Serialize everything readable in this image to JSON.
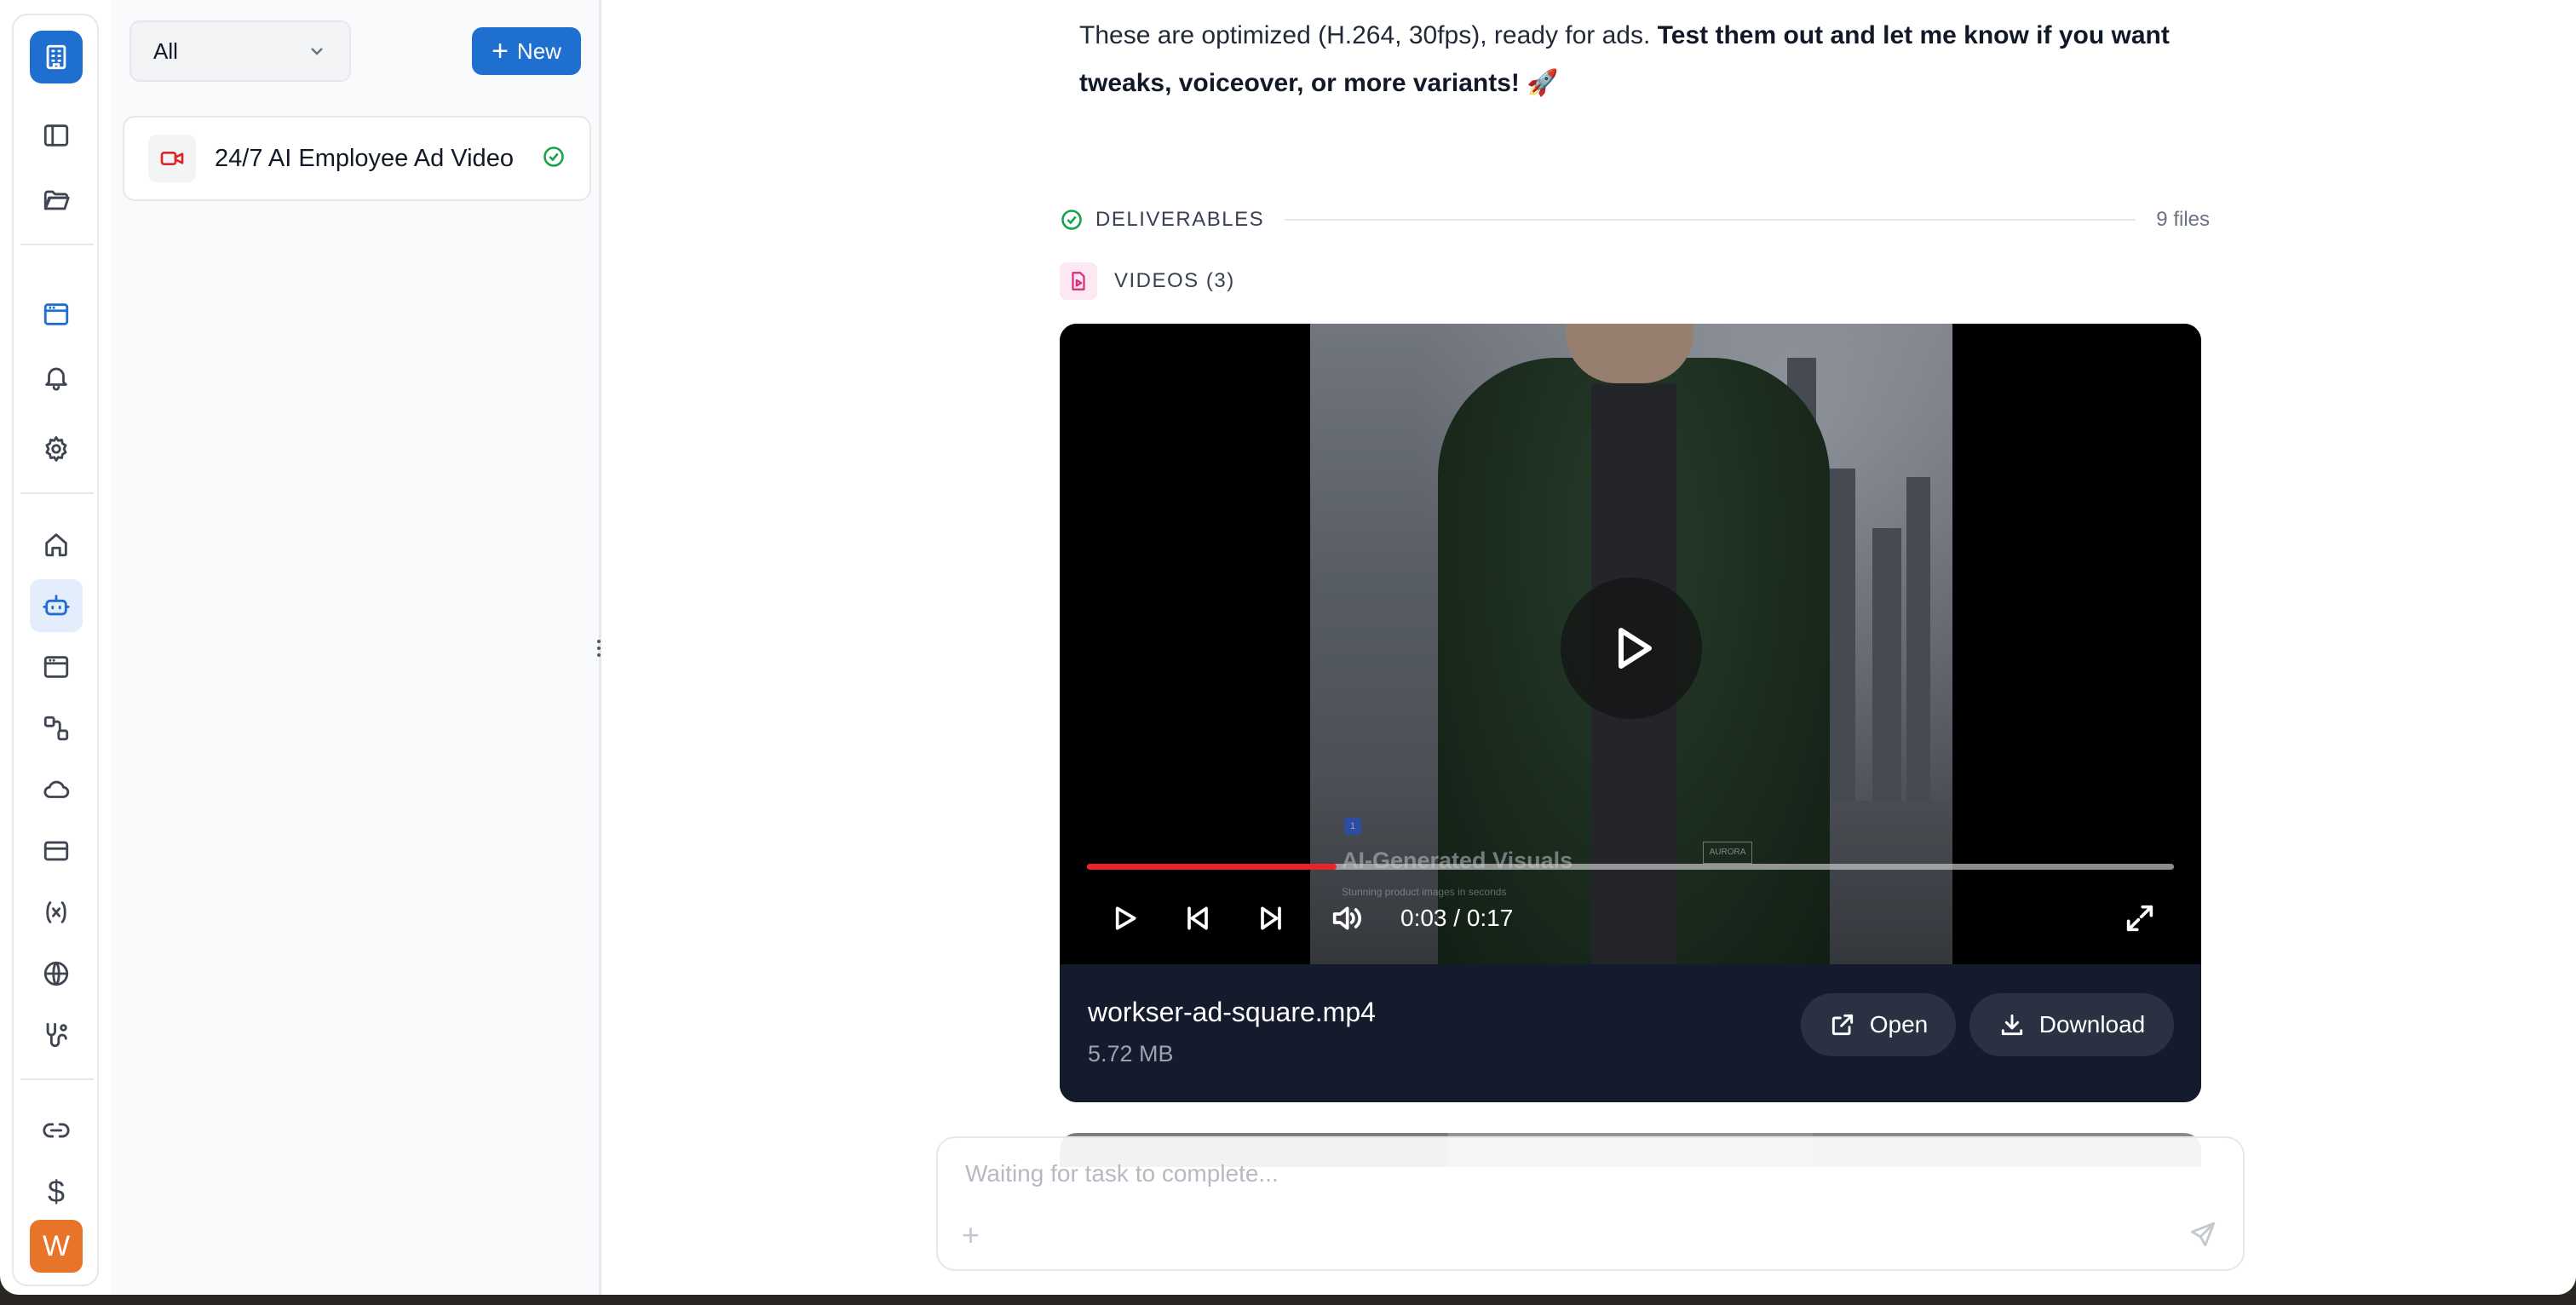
{
  "sidebar": {
    "filter_value": "All",
    "new_label": "New",
    "user_initial": "W",
    "dollar_symbol": "$"
  },
  "tasks": [
    {
      "title": "24/7 AI Employee Ad Video",
      "status": "completed"
    }
  ],
  "message": {
    "plain": "These are optimized (H.264, 30fps), ready for ads. ",
    "bold": "Test them out and let me know if you want tweaks, voiceover, or more variants! 🚀"
  },
  "deliverables": {
    "label": "DELIVERABLES",
    "count": "9 files",
    "videos_label": "VIDEOS (3)"
  },
  "video": {
    "time": "0:03 / 0:17",
    "progress": 0.23,
    "watermark_title": "AI-Generated Visuals",
    "watermark_sub": "Stunning product images in seconds",
    "watermark_brand": "AURORA",
    "file_name": "workser-ad-square.mp4",
    "file_size": "5.72 MB",
    "open_label": "Open",
    "download_label": "Download"
  },
  "composer": {
    "placeholder": "Waiting for task to complete..."
  },
  "colors": {
    "accent": "#1f6fd1",
    "success": "#16a34a",
    "progress": "#e5252a",
    "avatar": "#e8742a",
    "card_footer": "#141b2d"
  }
}
